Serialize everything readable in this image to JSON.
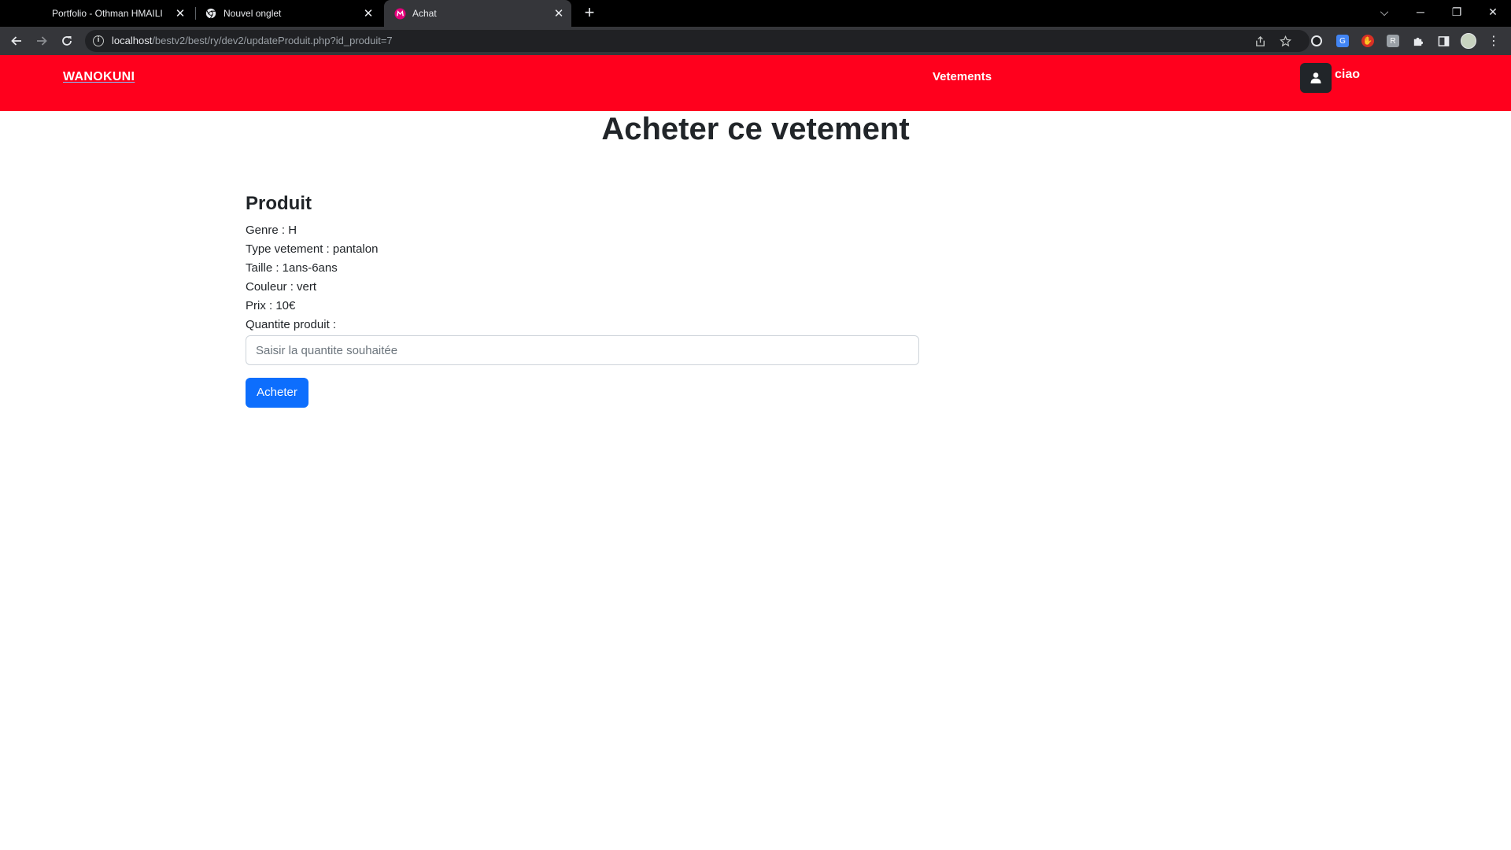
{
  "browser": {
    "tabs": [
      {
        "title": "Portfolio - Othman HMAILI",
        "active": false,
        "favicon": "none"
      },
      {
        "title": "Nouvel onglet",
        "active": false,
        "favicon": "chrome-icon"
      },
      {
        "title": "Achat",
        "active": true,
        "favicon": "page-favicon"
      }
    ],
    "close_glyph": "✕",
    "new_tab_glyph": "+",
    "window": {
      "chevron": "⌵",
      "minimize": "─",
      "restore": "❐",
      "close": "✕"
    },
    "url_host": "localhost",
    "url_path": "/bestv2/best/ry/dev2/updateProduit.php?id_produit=7",
    "colors": {
      "tabbar": "#000000",
      "toolbar": "#35363a",
      "omnibox": "#202124"
    }
  },
  "navbar": {
    "brand": "WANOKUNI",
    "link": "Vetements",
    "user": "ciao",
    "color": "#ff001d"
  },
  "page": {
    "title": "Acheter ce vetement"
  },
  "product": {
    "heading": "Produit",
    "genre": "Genre : H",
    "type": "Type vetement : pantalon",
    "taille": "Taille : 1ans-6ans",
    "couleur": "Couleur : vert",
    "prix": "Prix : 10€",
    "quantite_label": "Quantite produit :",
    "quantite_placeholder": "Saisir la quantite souhaitée",
    "quantite_value": "",
    "buy_label": "Acheter",
    "button_color": "#0d6efd"
  }
}
